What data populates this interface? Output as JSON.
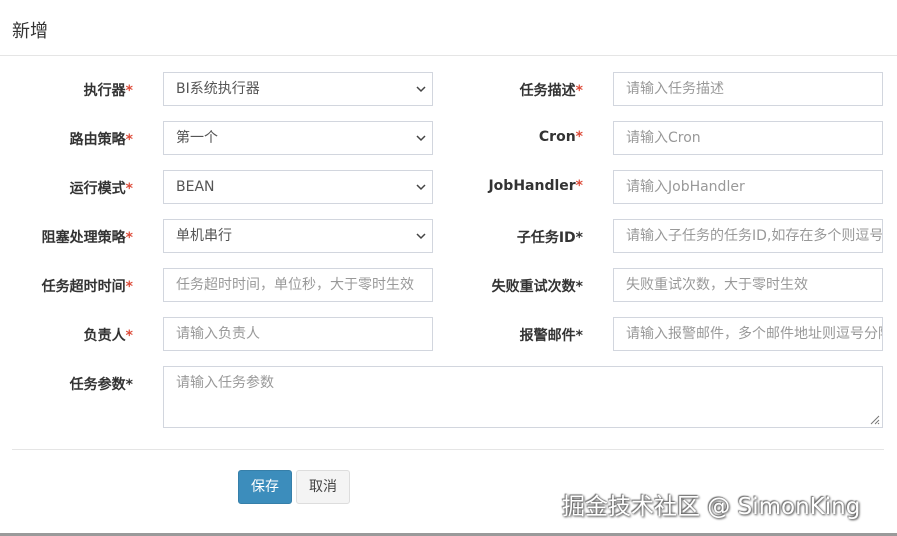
{
  "modal": {
    "title": "新增"
  },
  "form": {
    "left": [
      {
        "label": "执行器",
        "required": "*",
        "type": "select",
        "value": "BI系统执行器"
      },
      {
        "label": "路由策略",
        "required": "*",
        "type": "select",
        "value": "第一个"
      },
      {
        "label": "运行模式",
        "required": "*",
        "type": "select",
        "value": "BEAN"
      },
      {
        "label": "阻塞处理策略",
        "required": "*",
        "type": "select",
        "value": "单机串行"
      },
      {
        "label": "任务超时时间",
        "required": "*",
        "type": "input",
        "placeholder": "任务超时时间，单位秒，大于零时生效"
      },
      {
        "label": "负责人",
        "required": "*",
        "type": "input",
        "placeholder": "请输入负责人"
      }
    ],
    "right": [
      {
        "label": "任务描述",
        "required": "*",
        "type": "input",
        "placeholder": "请输入任务描述"
      },
      {
        "label": "Cron",
        "required": "*",
        "type": "input",
        "placeholder": "请输入Cron"
      },
      {
        "label": "JobHandler",
        "required": "*",
        "type": "input",
        "placeholder": "请输入JobHandler"
      },
      {
        "label": "子任务ID",
        "required": "*",
        "type": "input",
        "placeholder": "请输入子任务的任务ID,如存在多个则逗号分隔"
      },
      {
        "label": "失败重试次数",
        "required": "*",
        "type": "input",
        "placeholder": "失败重试次数，大于零时生效"
      },
      {
        "label": "报警邮件",
        "required": "*",
        "type": "input",
        "placeholder": "请输入报警邮件，多个邮件地址则逗号分隔"
      }
    ],
    "params": {
      "label": "任务参数",
      "required": "*",
      "placeholder": "请输入任务参数"
    }
  },
  "buttons": {
    "save": "保存",
    "cancel": "取消"
  },
  "watermark": "掘金技术社区 @ SimonKing",
  "colors": {
    "primary": "#3c8dbc",
    "required": "#dd4b39",
    "border": "#d2d6de"
  },
  "icons": {
    "select_arrow": "chevron-down-icon",
    "resize": "resize-grip-icon"
  }
}
